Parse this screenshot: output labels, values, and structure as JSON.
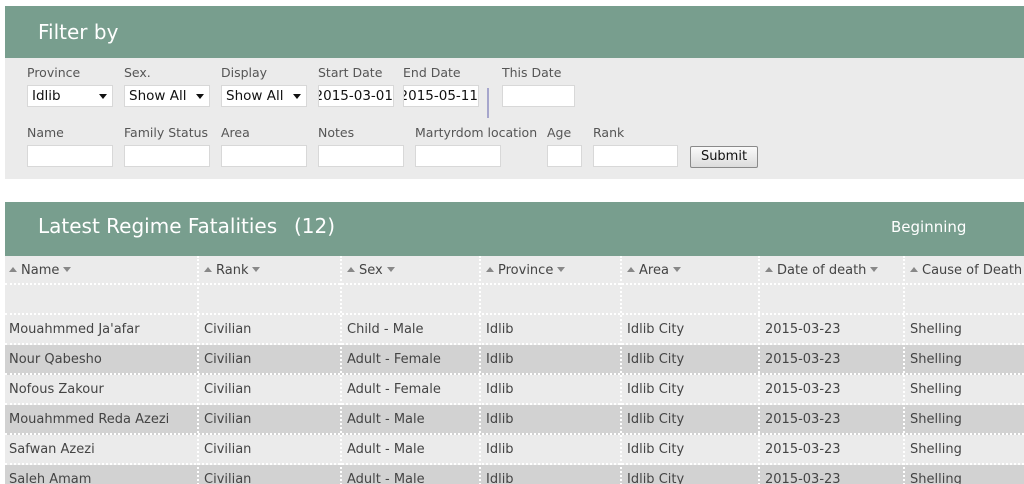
{
  "filter": {
    "title": "Filter by",
    "province": {
      "label": "Province",
      "value": "Idlib"
    },
    "sex": {
      "label": "Sex.",
      "value": "Show All"
    },
    "display": {
      "label": "Display",
      "value": "Show All"
    },
    "start_date": {
      "label": "Start Date",
      "value": "2015-03-01"
    },
    "end_date": {
      "label": "End Date",
      "value": "2015-05-11"
    },
    "this_date": {
      "label": "This Date",
      "value": ""
    },
    "name": {
      "label": "Name",
      "value": ""
    },
    "family_status": {
      "label": "Family Status",
      "value": ""
    },
    "area": {
      "label": "Area",
      "value": ""
    },
    "notes": {
      "label": "Notes",
      "value": ""
    },
    "martyrdom_location": {
      "label": "Martyrdom location",
      "value": ""
    },
    "age": {
      "label": "Age",
      "value": ""
    },
    "rank": {
      "label": "Rank",
      "value": ""
    },
    "submit_label": "Submit"
  },
  "fatalities": {
    "title": "Latest Regime Fatalities",
    "count": "(12)",
    "beginning_link": "Beginning",
    "columns": [
      "Name",
      "Rank",
      "Sex",
      "Province",
      "Area",
      "Date of death",
      "Cause of Death"
    ],
    "rows": [
      [
        "Mouahmmed Ja'afar",
        "Civilian",
        "Child - Male",
        "Idlib",
        "Idlib City",
        "2015-03-23",
        "Shelling"
      ],
      [
        "Nour Qabesho",
        "Civilian",
        "Adult - Female",
        "Idlib",
        "Idlib City",
        "2015-03-23",
        "Shelling"
      ],
      [
        "Nofous Zakour",
        "Civilian",
        "Adult - Female",
        "Idlib",
        "Idlib City",
        "2015-03-23",
        "Shelling"
      ],
      [
        "Mouahmmed Reda Azezi",
        "Civilian",
        "Adult - Male",
        "Idlib",
        "Idlib City",
        "2015-03-23",
        "Shelling"
      ],
      [
        "Safwan Azezi",
        "Civilian",
        "Adult - Male",
        "Idlib",
        "Idlib City",
        "2015-03-23",
        "Shelling"
      ],
      [
        "Saleh Amam",
        "Civilian",
        "Adult - Male",
        "Idlib",
        "Idlib City",
        "2015-03-23",
        "Shelling"
      ]
    ]
  }
}
